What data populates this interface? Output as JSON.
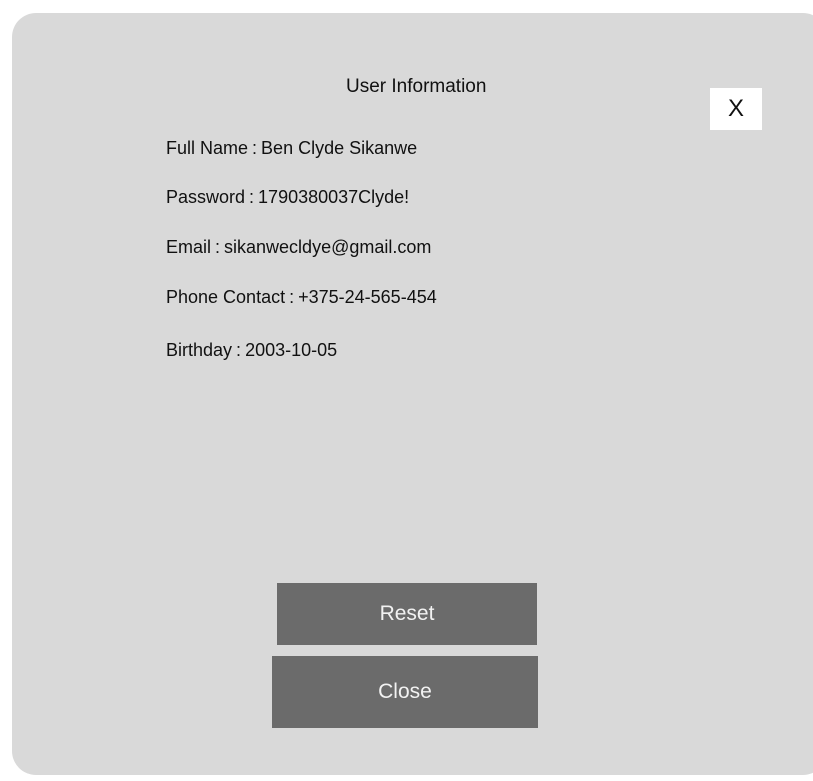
{
  "dialog": {
    "title": "User Information",
    "close_icon_label": "X",
    "fields": [
      {
        "label": "Full Name",
        "value": "Ben Clyde Sikanwe"
      },
      {
        "label": "Password",
        "value": "1790380037Clyde!"
      },
      {
        "label": "Email",
        "value": "sikanwecldye@gmail.com"
      },
      {
        "label": "Phone Contact",
        "value": "+375-24-565-454"
      },
      {
        "label": "Birthday",
        "value": "2003-10-05"
      }
    ],
    "buttons": {
      "reset": "Reset",
      "close": "Close"
    }
  },
  "colors": {
    "dialog_background": "#d9d9d9",
    "button_background": "#6b6b6b",
    "button_text": "#f2f2f2",
    "close_icon_background": "#ffffff"
  }
}
